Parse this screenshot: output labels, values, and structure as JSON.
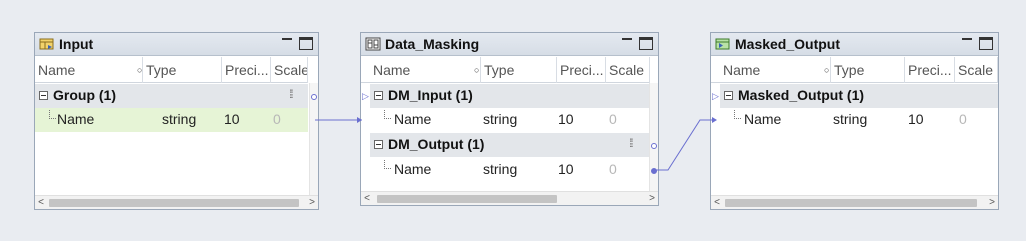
{
  "colors": {
    "canvas_bg": "#e9ecf1",
    "selected_row": "#e6f4d6",
    "group_row": "#e3e6ea",
    "link": "#6a6fd0"
  },
  "columns": {
    "name": "Name",
    "type": "Type",
    "precision": "Preci...",
    "scale": "Scale"
  },
  "nodes": {
    "input": {
      "title": "Input",
      "icon": "source-table-icon",
      "group_label": "Group (1)",
      "fields": [
        {
          "name": "Name",
          "type": "string",
          "precision": "10",
          "scale": "0"
        }
      ]
    },
    "masking": {
      "title": "Data_Masking",
      "icon": "masking-transformation-icon",
      "input_group_label": "DM_Input (1)",
      "input_fields": [
        {
          "name": "Name",
          "type": "string",
          "precision": "10",
          "scale": "0"
        }
      ],
      "output_group_label": "DM_Output (1)",
      "output_fields": [
        {
          "name": "Name",
          "type": "string",
          "precision": "10",
          "scale": "0"
        }
      ]
    },
    "output": {
      "title": "Masked_Output",
      "icon": "target-table-icon",
      "group_label": "Masked_Output (1)",
      "fields": [
        {
          "name": "Name",
          "type": "string",
          "precision": "10",
          "scale": "0"
        }
      ]
    }
  }
}
